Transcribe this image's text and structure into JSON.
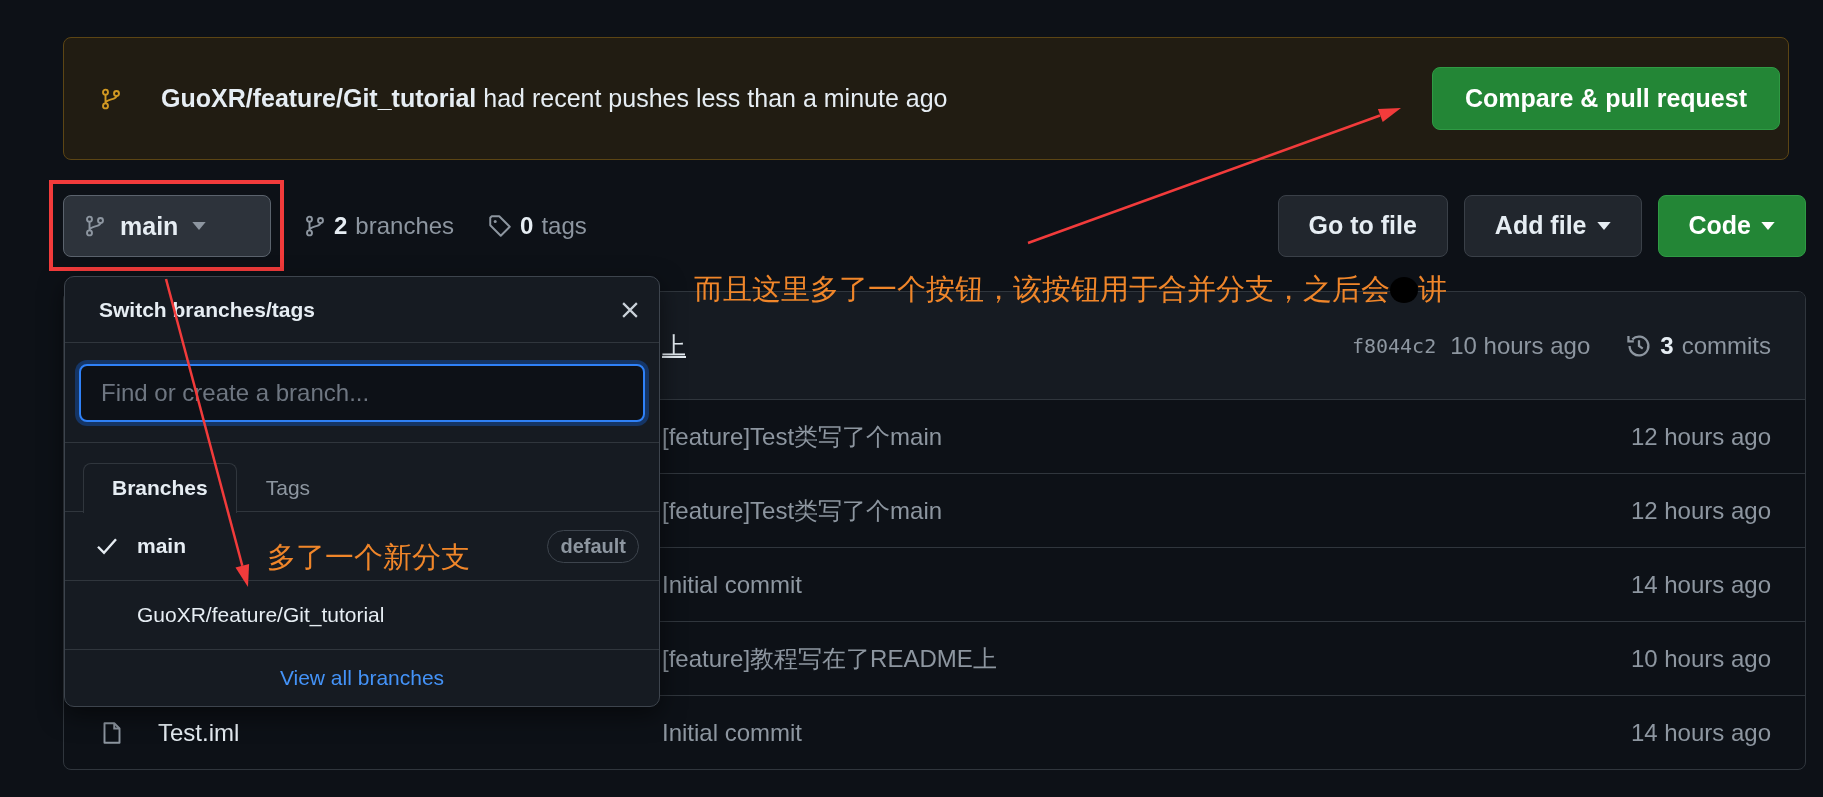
{
  "banner": {
    "message": "**GuoXR/feature/Git_tutorial** had recent pushes less than a minute ago",
    "button": "Compare & pull request"
  },
  "toolbar": {
    "branch_button": "main",
    "branches_count": "2",
    "branches_label": "branches",
    "tags_count": "0",
    "tags_label": "tags",
    "buttons": [
      {
        "label": "Go to file",
        "kind": "plain"
      },
      {
        "label": "Add file",
        "kind": "menu"
      },
      {
        "label": "Code",
        "kind": "primary"
      }
    ]
  },
  "files": {
    "latest_commit": {
      "message": "上",
      "hash": "f8044c2",
      "time": "10 hours ago",
      "commits_count": "3",
      "commits_label": "commits"
    },
    "rows": [
      {
        "message": "[feature]Test类写了个main",
        "time": "12 hours ago"
      },
      {
        "message": "[feature]Test类写了个main",
        "time": "12 hours ago"
      },
      {
        "message": "Initial commit",
        "time": "14 hours ago"
      },
      {
        "message": "[feature]教程写在了README上",
        "time": "10 hours ago"
      },
      {
        "name": "Test.iml",
        "message": "Initial commit",
        "time": "14 hours ago"
      }
    ]
  },
  "branch_menu": {
    "title": "Switch branches/tags",
    "search": {
      "placeholder": "Find or create a branch..."
    },
    "tabs": [
      {
        "label": "Branches",
        "selected": true
      },
      {
        "label": "Tags",
        "selected": false
      }
    ],
    "branches": [
      {
        "name": "main",
        "checked": true,
        "badge": "default"
      },
      {
        "name": "GuoXR/feature/Git_tutorial",
        "checked": false
      }
    ],
    "footer_link": "View all branches"
  },
  "annotations": [
    {
      "text": "而且这里多了一个按钮，该按钮用于合并分支，之后会",
      "after_redaction": "讲"
    },
    {
      "text": "多了一个新分支"
    }
  ]
}
